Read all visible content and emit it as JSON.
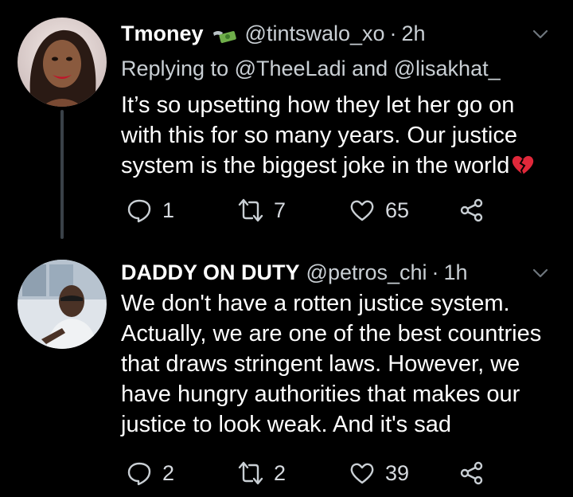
{
  "tweets": [
    {
      "name": "Tmoney",
      "handle": "@tintswalo_xo",
      "dot": "·",
      "time": "2h",
      "replying_to": "Replying to @TheeLadi and @lisakhat_",
      "text": "It’s so upsetting how they let her go on\nwith this for so many years. Our justice\nsystem is the biggest joke in the world",
      "replies": "1",
      "retweets": "7",
      "likes": "65"
    },
    {
      "name": "DADDY ON DUTY",
      "handle": "@petros_chi",
      "dot": "·",
      "time": "1h",
      "text": "We don't have a rotten justice system.\nActually, we are one of the best countries\nthat draws stringent laws. However, we\nhave hungry authorities that makes our\njustice to look weak. And it's sad",
      "replies": "2",
      "retweets": "2",
      "likes": "39"
    }
  ],
  "colors": {
    "background": "#000000",
    "secondary_text": "#c9cfd4",
    "icon": "#c9cfd4",
    "thread_line": "#3a4148"
  },
  "icons": [
    "money-with-wings-emoji",
    "broken-heart-emoji",
    "reply-icon",
    "retweet-icon",
    "like-icon",
    "share-icon",
    "chevron-down-icon"
  ]
}
